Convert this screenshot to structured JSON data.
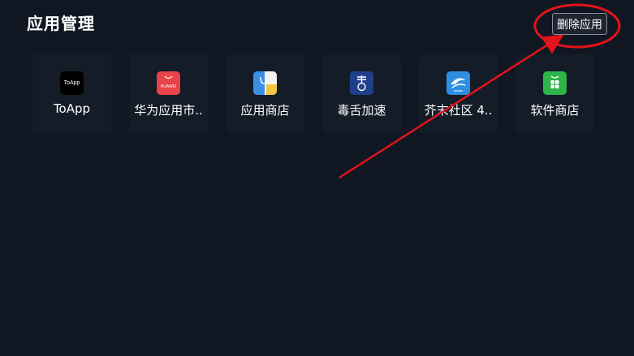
{
  "header": {
    "title": "应用管理",
    "delete_button_label": "删除应用"
  },
  "apps": [
    {
      "label": "ToApp",
      "icon": "toapp-icon",
      "icon_text": "ToApp",
      "icon_bg": "#000000"
    },
    {
      "label": "华为应用市..",
      "icon": "huawei-appgallery-icon",
      "icon_text": "HUAWEI",
      "icon_bg": "#e8434b"
    },
    {
      "label": "应用商店",
      "icon": "app-store-icon",
      "icon_bg": "#3a8ee8"
    },
    {
      "label": "毒舌加速",
      "icon": "dushe-accelerator-icon",
      "icon_bg": "#1f3f8a"
    },
    {
      "label": "芥末社区 4..",
      "icon": "jiemo-community-icon",
      "icon_bg": "#2e8fe0"
    },
    {
      "label": "软件商店",
      "icon": "software-store-icon",
      "icon_bg": "#2fb44a"
    }
  ],
  "colors": {
    "background": "#101722",
    "tile": "#141c28",
    "annotation": "#e3131b"
  }
}
